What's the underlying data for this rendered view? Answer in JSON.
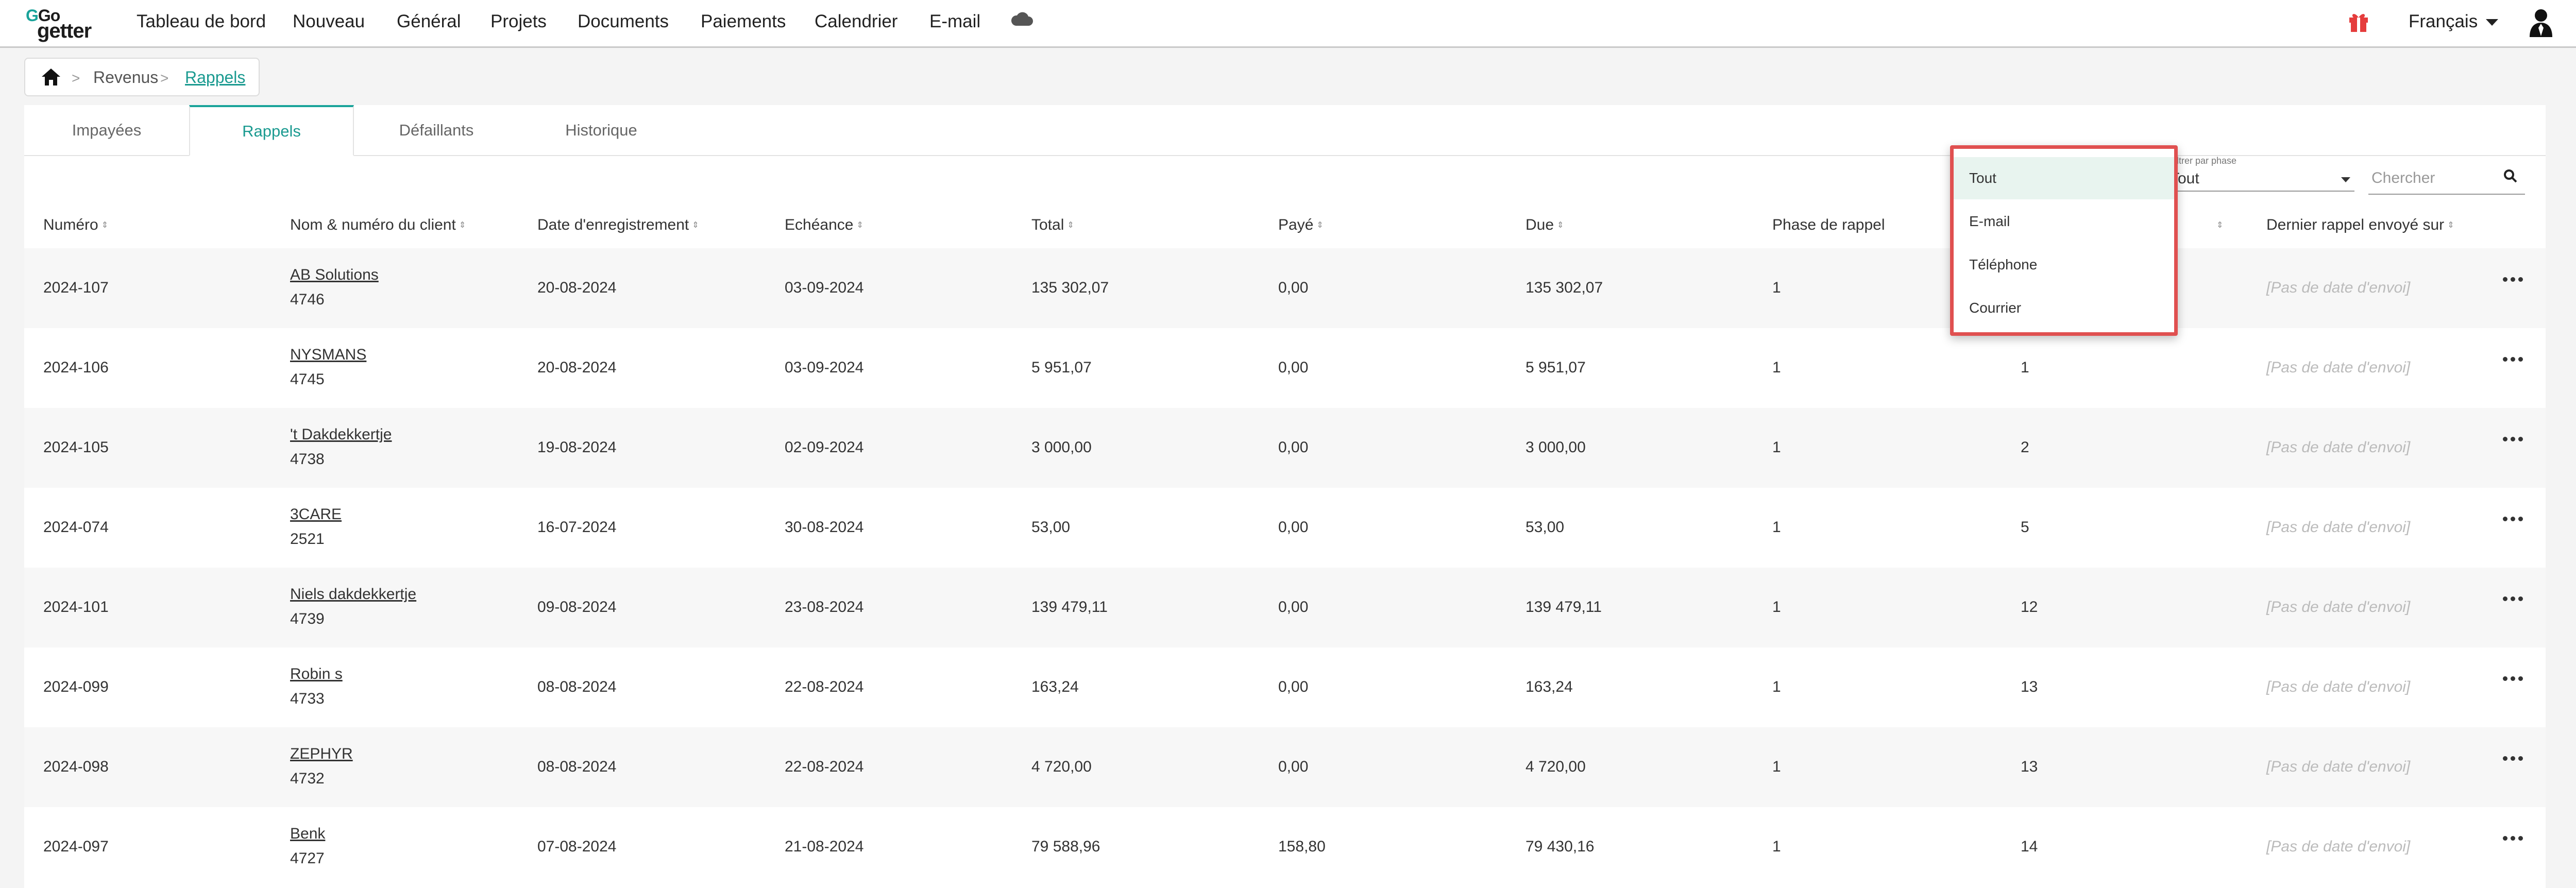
{
  "brand": {
    "logo_top": "Go",
    "logo_bottom": "getter",
    "accent": "#1aa39a"
  },
  "nav": {
    "items": [
      "Tableau de bord",
      "Nouveau",
      "Général",
      "Projets",
      "Documents",
      "Paiements",
      "Calendrier",
      "E-mail"
    ],
    "language": "Français"
  },
  "breadcrumb": {
    "level1": "Revenus",
    "current": "Rappels"
  },
  "tabs": [
    "Impayées",
    "Rappels",
    "Défaillants",
    "Historique"
  ],
  "filters": {
    "phase_label": "Filtrer par phase",
    "phase_value": "Tout",
    "method_value": "Tout",
    "search_placeholder": "Chercher"
  },
  "dropdown": {
    "options": [
      "Tout",
      "E-mail",
      "Téléphone",
      "Courrier"
    ],
    "selected": "Tout"
  },
  "table": {
    "columns": [
      "Numéro",
      "Nom & numéro du client",
      "Date d'enregistrement",
      "Echéance",
      "Total",
      "Payé",
      "Due",
      "Phase de rappel",
      "",
      "Dernier rappel envoyé sur"
    ],
    "rows": [
      {
        "num": "2024-107",
        "client": "AB Solutions",
        "client_no": "4746",
        "reg": "20-08-2024",
        "due_date": "03-09-2024",
        "total": "135 302,07",
        "paid": "0,00",
        "due": "135 302,07",
        "phase": "1",
        "days": "",
        "last": "[Pas de date d'envoi]"
      },
      {
        "num": "2024-106",
        "client": "NYSMANS",
        "client_no": "4745",
        "reg": "20-08-2024",
        "due_date": "03-09-2024",
        "total": "5 951,07",
        "paid": "0,00",
        "due": "5 951,07",
        "phase": "1",
        "days": "1",
        "last": "[Pas de date d'envoi]"
      },
      {
        "num": "2024-105",
        "client": "'t Dakdekkertje",
        "client_no": "4738",
        "reg": "19-08-2024",
        "due_date": "02-09-2024",
        "total": "3 000,00",
        "paid": "0,00",
        "due": "3 000,00",
        "phase": "1",
        "days": "2",
        "last": "[Pas de date d'envoi]"
      },
      {
        "num": "2024-074",
        "client": "3CARE",
        "client_no": "2521",
        "reg": "16-07-2024",
        "due_date": "30-08-2024",
        "total": "53,00",
        "paid": "0,00",
        "due": "53,00",
        "phase": "1",
        "days": "5",
        "last": "[Pas de date d'envoi]"
      },
      {
        "num": "2024-101",
        "client": "Niels dakdekkertje",
        "client_no": "4739",
        "reg": "09-08-2024",
        "due_date": "23-08-2024",
        "total": "139 479,11",
        "paid": "0,00",
        "due": "139 479,11",
        "phase": "1",
        "days": "12",
        "last": "[Pas de date d'envoi]"
      },
      {
        "num": "2024-099",
        "client": "Robin s",
        "client_no": "4733",
        "reg": "08-08-2024",
        "due_date": "22-08-2024",
        "total": "163,24",
        "paid": "0,00",
        "due": "163,24",
        "phase": "1",
        "days": "13",
        "last": "[Pas de date d'envoi]"
      },
      {
        "num": "2024-098",
        "client": "ZEPHYR",
        "client_no": "4732",
        "reg": "08-08-2024",
        "due_date": "22-08-2024",
        "total": "4 720,00",
        "paid": "0,00",
        "due": "4 720,00",
        "phase": "1",
        "days": "13",
        "last": "[Pas de date d'envoi]"
      },
      {
        "num": "2024-097",
        "client": "Benk",
        "client_no": "4727",
        "reg": "07-08-2024",
        "due_date": "21-08-2024",
        "total": "79 588,96",
        "paid": "158,80",
        "due": "79 430,16",
        "phase": "1",
        "days": "14",
        "last": "[Pas de date d'envoi]"
      }
    ]
  }
}
